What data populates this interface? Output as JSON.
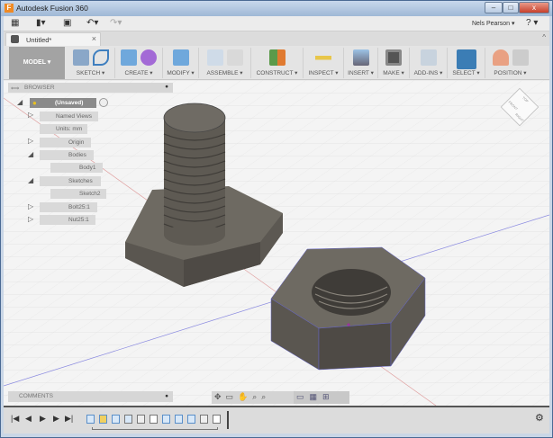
{
  "window": {
    "title": "Autodesk Fusion 360",
    "logo": "F",
    "min": "–",
    "max": "□",
    "close": "x"
  },
  "quickbar": {
    "user": "Nels Pearson ▾",
    "help": "? ▾",
    "grid_icon": "▦",
    "file_icon": "▮▾",
    "save_icon": "▣",
    "undo_icon": "↶▾",
    "redo_icon": "↷▾"
  },
  "tab": {
    "label": "Untitled*",
    "close": "×",
    "collapse": "^"
  },
  "ribbon": {
    "workspace": "MODEL ▾",
    "groups": [
      "SKETCH ▾",
      "CREATE ▾",
      "MODIFY ▾",
      "ASSEMBLE ▾",
      "CONSTRUCT ▾",
      "INSPECT ▾",
      "INSERT ▾",
      "MAKE ▾",
      "ADD-INS ▾",
      "SELECT ▾",
      "POSITION ▾"
    ]
  },
  "browser": {
    "title": "BROWSER",
    "nodes": [
      "(Unsaved)",
      "Named Views",
      "Units: mm",
      "Origin",
      "Bodies",
      "Body1",
      "Sketches",
      "Sketch2",
      "Bolt25:1",
      "Nut25:1"
    ]
  },
  "comments": {
    "title": "COMMENTS"
  },
  "viewcube": {
    "front": "FRONT",
    "right": "RIGHT",
    "top": "TOP"
  },
  "timeline": {
    "controls": [
      "|◀",
      "◀",
      "▶",
      "▶",
      "▶|"
    ],
    "settings": "⚙"
  },
  "colors": {
    "accent": "#3f7fbf",
    "select": "#3b7db5",
    "model": "#a3a3a3"
  }
}
